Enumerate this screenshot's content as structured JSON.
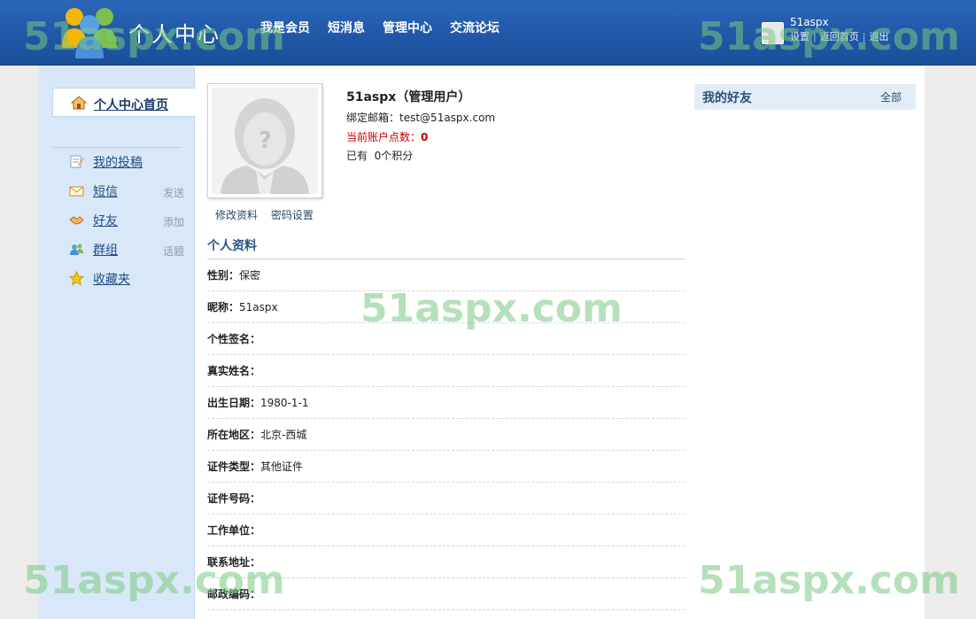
{
  "header": {
    "title": "个人中心",
    "nav": [
      "我是会员",
      "短消息",
      "管理中心",
      "交流论坛"
    ],
    "user": {
      "name": "51aspx",
      "links": [
        "设置",
        "返回首页",
        "退出"
      ]
    }
  },
  "sidebar": {
    "home": {
      "label": "个人中心首页",
      "icon": "home-icon"
    },
    "items": [
      {
        "label": "我的投稿",
        "action": "",
        "icon": "edit-icon"
      },
      {
        "label": "短信",
        "action": "发送",
        "icon": "envelope-icon"
      },
      {
        "label": "好友",
        "action": "添加",
        "icon": "handshake-icon"
      },
      {
        "label": "群组",
        "action": "话题",
        "icon": "group-icon"
      },
      {
        "label": "收藏夹",
        "action": "",
        "icon": "star-icon"
      }
    ]
  },
  "profile": {
    "name": "51aspx（管理用户）",
    "email_label": "绑定邮箱：",
    "email": "test@51aspx.com",
    "points_label": "当前账户点数：",
    "points": "0",
    "score_prefix": "已有",
    "score_value": "0个积分",
    "edit_link": "修改资料",
    "password_link": "密码设置"
  },
  "section": {
    "title": "个人资料",
    "fields": [
      {
        "label": "性别：",
        "value": "保密"
      },
      {
        "label": "昵称：",
        "value": "51aspx"
      },
      {
        "label": "个性签名：",
        "value": ""
      },
      {
        "label": "真实姓名：",
        "value": ""
      },
      {
        "label": "出生日期：",
        "value": "1980-1-1"
      },
      {
        "label": "所在地区：",
        "value": "北京-西城"
      },
      {
        "label": "证件类型：",
        "value": "其他证件"
      },
      {
        "label": "证件号码：",
        "value": ""
      },
      {
        "label": "工作单位：",
        "value": ""
      },
      {
        "label": "联系地址：",
        "value": ""
      },
      {
        "label": "邮政编码：",
        "value": ""
      }
    ]
  },
  "friends": {
    "title": "我的好友",
    "all_link": "全部"
  },
  "watermark": "51aspx.com",
  "colors": {
    "header": "#1f57a6",
    "sidebar": "#d9e8f8",
    "points": "#c40000",
    "section_title": "#2c5784"
  }
}
